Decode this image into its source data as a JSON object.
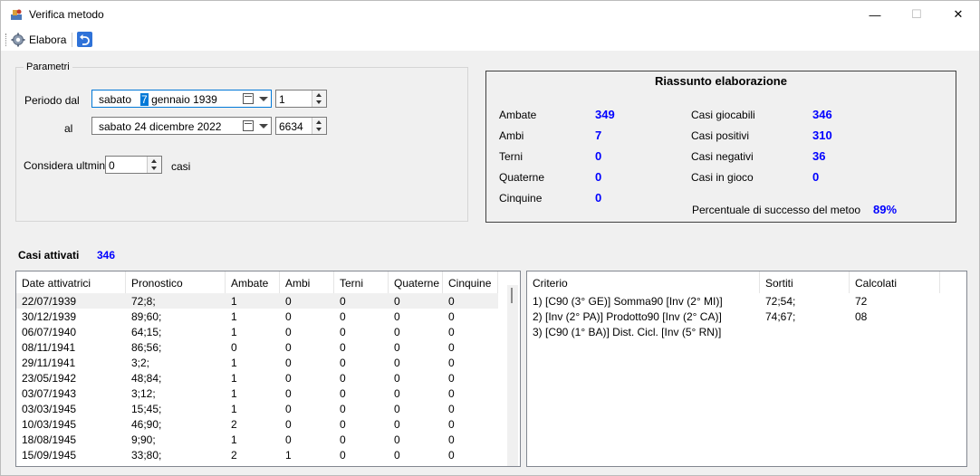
{
  "window": {
    "title": "Verifica metodo",
    "minimize_glyph": "—",
    "maximize_glyph": "☐",
    "close_glyph": "✕"
  },
  "toolbar": {
    "elabora_label": "Elabora",
    "undo_icon": "undo-icon"
  },
  "parametri": {
    "legend": "Parametri",
    "periodo_dal_label": "Periodo dal",
    "al_label": "al",
    "from_date": {
      "weekday": "sabato",
      "day": "7",
      "month_year": "gennaio  1939"
    },
    "from_number": "1",
    "to_date": "sabato   24 dicembre  2022",
    "to_number": "6634",
    "considera_label": "Considera ultmini",
    "considera_value": "0",
    "casi_label": "casi"
  },
  "riassunto": {
    "title": "Riassunto elaborazione",
    "left": [
      {
        "label": "Ambate",
        "value": "349"
      },
      {
        "label": "Ambi",
        "value": "7"
      },
      {
        "label": "Terni",
        "value": "0"
      },
      {
        "label": "Quaterne",
        "value": "0"
      },
      {
        "label": "Cinquine",
        "value": "0"
      }
    ],
    "right": [
      {
        "label": "Casi giocabili",
        "value": "346"
      },
      {
        "label": "Casi positivi",
        "value": "310"
      },
      {
        "label": "Casi negativi",
        "value": "36"
      },
      {
        "label": "Casi in gioco",
        "value": "0"
      }
    ],
    "percent_label": "Percentuale di successo del metoo",
    "percent_value": "89%"
  },
  "casi_attivati": {
    "label": "Casi attivati",
    "value": "346"
  },
  "results_table": {
    "headers": [
      "Date attivatrici",
      "Pronostico",
      "Ambate",
      "Ambi",
      "Terni",
      "Quaterne",
      "Cinquine"
    ],
    "rows": [
      [
        "22/07/1939",
        "72;8;",
        "1",
        "0",
        "0",
        "0",
        "0"
      ],
      [
        "30/12/1939",
        "89;60;",
        "1",
        "0",
        "0",
        "0",
        "0"
      ],
      [
        "06/07/1940",
        "64;15;",
        "1",
        "0",
        "0",
        "0",
        "0"
      ],
      [
        "08/11/1941",
        "86;56;",
        "0",
        "0",
        "0",
        "0",
        "0"
      ],
      [
        "29/11/1941",
        "3;2;",
        "1",
        "0",
        "0",
        "0",
        "0"
      ],
      [
        "23/05/1942",
        "48;84;",
        "1",
        "0",
        "0",
        "0",
        "0"
      ],
      [
        "03/07/1943",
        "3;12;",
        "1",
        "0",
        "0",
        "0",
        "0"
      ],
      [
        "03/03/1945",
        "15;45;",
        "1",
        "0",
        "0",
        "0",
        "0"
      ],
      [
        "10/03/1945",
        "46;90;",
        "2",
        "0",
        "0",
        "0",
        "0"
      ],
      [
        "18/08/1945",
        "9;90;",
        "1",
        "0",
        "0",
        "0",
        "0"
      ],
      [
        "15/09/1945",
        "33;80;",
        "2",
        "1",
        "0",
        "0",
        "0"
      ]
    ]
  },
  "criteria_table": {
    "headers": [
      "Criterio",
      "Sortiti",
      "Calcolati"
    ],
    "rows": [
      [
        "1) [C90 (3° GE)]  Somma90 [Inv (2° MI)]",
        "72;54;",
        "72"
      ],
      [
        "2) [Inv (2° PA)]  Prodotto90 [Inv (2° CA)]",
        "74;67;",
        "08"
      ],
      [
        "3) [C90 (1° BA)]  Dist. Cicl. [Inv (5° RN)]",
        "",
        ""
      ]
    ]
  }
}
